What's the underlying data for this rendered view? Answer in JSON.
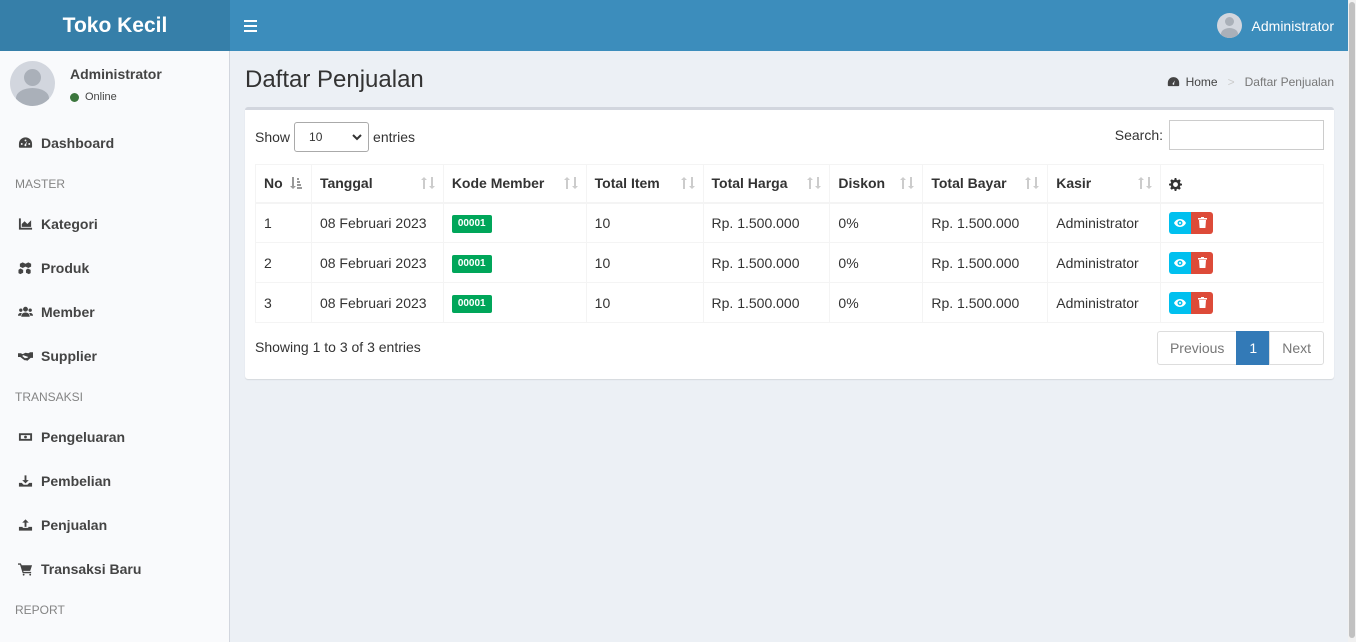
{
  "app": {
    "brand": "Toko Kecil"
  },
  "navbar": {
    "user_name": "Administrator"
  },
  "sidebar": {
    "user_name": "Administrator",
    "user_status": "Online",
    "items": [
      {
        "type": "item",
        "label": "Dashboard",
        "icon": "dashboard-icon"
      },
      {
        "type": "header",
        "label": "MASTER"
      },
      {
        "type": "item",
        "label": "Kategori",
        "icon": "chart-icon"
      },
      {
        "type": "item",
        "label": "Produk",
        "icon": "cubes-icon"
      },
      {
        "type": "item",
        "label": "Member",
        "icon": "users-icon"
      },
      {
        "type": "item",
        "label": "Supplier",
        "icon": "handshake-icon"
      },
      {
        "type": "header",
        "label": "TRANSAKSI"
      },
      {
        "type": "item",
        "label": "Pengeluaran",
        "icon": "money-icon"
      },
      {
        "type": "item",
        "label": "Pembelian",
        "icon": "download-icon"
      },
      {
        "type": "item",
        "label": "Penjualan",
        "icon": "upload-icon"
      },
      {
        "type": "item",
        "label": "Transaksi Baru",
        "icon": "cart-icon"
      },
      {
        "type": "header",
        "label": "REPORT"
      }
    ]
  },
  "page": {
    "title": "Daftar Penjualan",
    "breadcrumb": {
      "home": "Home",
      "current": "Daftar Penjualan"
    }
  },
  "table_controls": {
    "show_label": "Show",
    "entries_label": "entries",
    "length_value": "10",
    "search_label": "Search:",
    "search_value": ""
  },
  "table": {
    "headers": [
      "No",
      "Tanggal",
      "Kode Member",
      "Total Item",
      "Total Harga",
      "Diskon",
      "Total Bayar",
      "Kasir"
    ],
    "rows": [
      {
        "no": "1",
        "tanggal": "08 Februari 2023",
        "kode_member": "00001",
        "total_item": "10",
        "total_harga": "Rp. 1.500.000",
        "diskon": "0%",
        "total_bayar": "Rp. 1.500.000",
        "kasir": "Administrator"
      },
      {
        "no": "2",
        "tanggal": "08 Februari 2023",
        "kode_member": "00001",
        "total_item": "10",
        "total_harga": "Rp. 1.500.000",
        "diskon": "0%",
        "total_bayar": "Rp. 1.500.000",
        "kasir": "Administrator"
      },
      {
        "no": "3",
        "tanggal": "08 Februari 2023",
        "kode_member": "00001",
        "total_item": "10",
        "total_harga": "Rp. 1.500.000",
        "diskon": "0%",
        "total_bayar": "Rp. 1.500.000",
        "kasir": "Administrator"
      }
    ]
  },
  "footer": {
    "info": "Showing 1 to 3 of 3 entries",
    "pagination": {
      "previous": "Previous",
      "current": "1",
      "next": "Next"
    }
  },
  "colors": {
    "header": "#3c8dbc",
    "logo": "#367fa9",
    "badge": "#00a65a",
    "view_button": "#00c0ef",
    "delete_button": "#dd4b39",
    "page_active": "#337ab7"
  }
}
